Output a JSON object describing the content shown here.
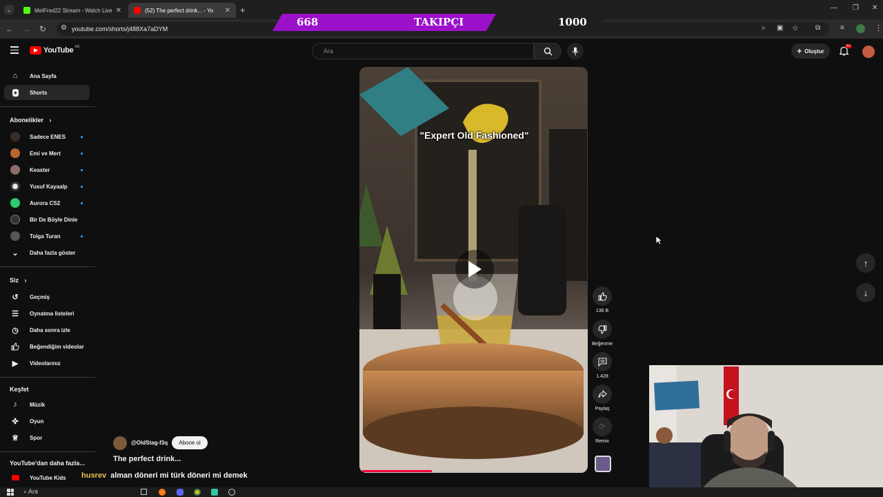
{
  "browser": {
    "tabs": [
      {
        "label": "MelFred22 Stream - Watch Live",
        "active": false
      },
      {
        "label": "(52) The perfect drink... - Yo",
        "active": true
      }
    ],
    "url": "youtube.com/shorts/j488Xa7aDYM"
  },
  "overlay": {
    "count": "668",
    "label": "TAKIPÇI",
    "goal": "1000",
    "colors": {
      "purple": "#9b11c9",
      "dark": "#1e1e1e"
    }
  },
  "header": {
    "logo": "YouTube",
    "region": "ME",
    "search_placeholder": "Ara",
    "create_label": "Oluştur",
    "notif_count": "9+"
  },
  "sidebar": {
    "main": [
      {
        "label": "Ana Sayfa",
        "icon": "home-icon"
      },
      {
        "label": "Shorts",
        "icon": "shorts-icon",
        "active": true
      }
    ],
    "subscriptions_header": "Abonelikler",
    "subscriptions": [
      {
        "label": "Sadece ENES",
        "color": "#3a2b24"
      },
      {
        "label": "Emi ve Mert",
        "color": "#b8662e"
      },
      {
        "label": "Keaxter",
        "color": "#8c6f66"
      },
      {
        "label": "Yusuf Kayaalp",
        "color": "#e8e8e8"
      },
      {
        "label": "Aurora CS2",
        "color": "#2ecc71"
      },
      {
        "label": "Bir De Böyle Dinle",
        "color": "#333333"
      },
      {
        "label": "Tolga Turan",
        "color": "#555555"
      }
    ],
    "show_more": "Daha fazla göster",
    "you_header": "Siz",
    "you": [
      {
        "label": "Geçmiş",
        "icon": "history-icon"
      },
      {
        "label": "Oynatma listeleri",
        "icon": "playlist-icon"
      },
      {
        "label": "Daha sonra izle",
        "icon": "clock-icon"
      },
      {
        "label": "Beğendiğim videolar",
        "icon": "like-icon"
      },
      {
        "label": "Videolarınız",
        "icon": "video-icon"
      }
    ],
    "explore_header": "Keşfet",
    "explore": [
      {
        "label": "Müzik",
        "icon": "music-icon"
      },
      {
        "label": "Oyun",
        "icon": "gaming-icon"
      },
      {
        "label": "Spor",
        "icon": "trophy-icon"
      }
    ],
    "more_header": "YouTube'dan daha fazla...",
    "more": [
      {
        "label": "YouTube Kids",
        "icon": "youtube-kids-icon"
      }
    ]
  },
  "short": {
    "overlay_title": "\"Expert Old Fashioned\"",
    "progress": 0.31,
    "channel": "@OldStag-f3q",
    "subscribe_label": "Abone ol",
    "title": "The perfect drink..."
  },
  "actions": {
    "likes": "136 B",
    "dislike_label": "Beğenme",
    "comments": "1.428",
    "share_label": "Paylaş",
    "remix_label": "Remix"
  },
  "chat": {
    "user": "husrev",
    "message": "alman döneri mi türk döneri mi demek"
  },
  "taskbar": {
    "search_label": "Ara"
  }
}
